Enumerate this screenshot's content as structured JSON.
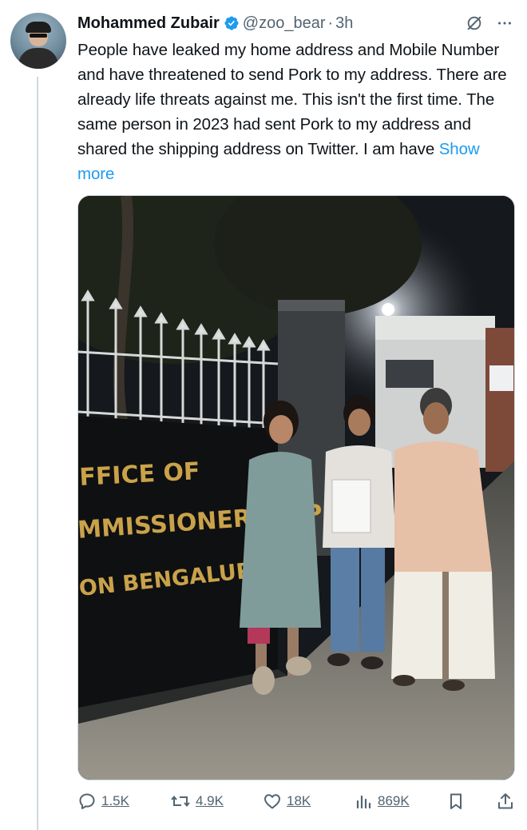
{
  "tweet": {
    "author_name": "Mohammed Zubair",
    "handle": "@zoo_bear",
    "separator": "·",
    "time": "3h",
    "text": "People have leaked my home address and Mobile Number and have threatened to send Pork to my address. There are already life threats against me. This isn't the first time. The same person in 2023 had sent Pork to my address and shared the shipping address on Twitter. I am have ",
    "show_more": "Show more"
  },
  "photo": {
    "sign_line1": "FFICE OF",
    "sign_line2": "MMISSIONER OF P",
    "sign_line3": "ON  BENGALURU CIT"
  },
  "actions": {
    "replies": "1.5K",
    "reposts": "4.9K",
    "likes": "18K",
    "views": "869K"
  },
  "colors": {
    "accent": "#1d9bf0",
    "muted": "#536471",
    "verified": "#1d9bf0"
  },
  "icons": [
    "grok-icon",
    "more-icon",
    "verified-badge-icon",
    "reply-icon",
    "retweet-icon",
    "like-icon",
    "views-icon",
    "bookmark-icon",
    "share-icon"
  ]
}
